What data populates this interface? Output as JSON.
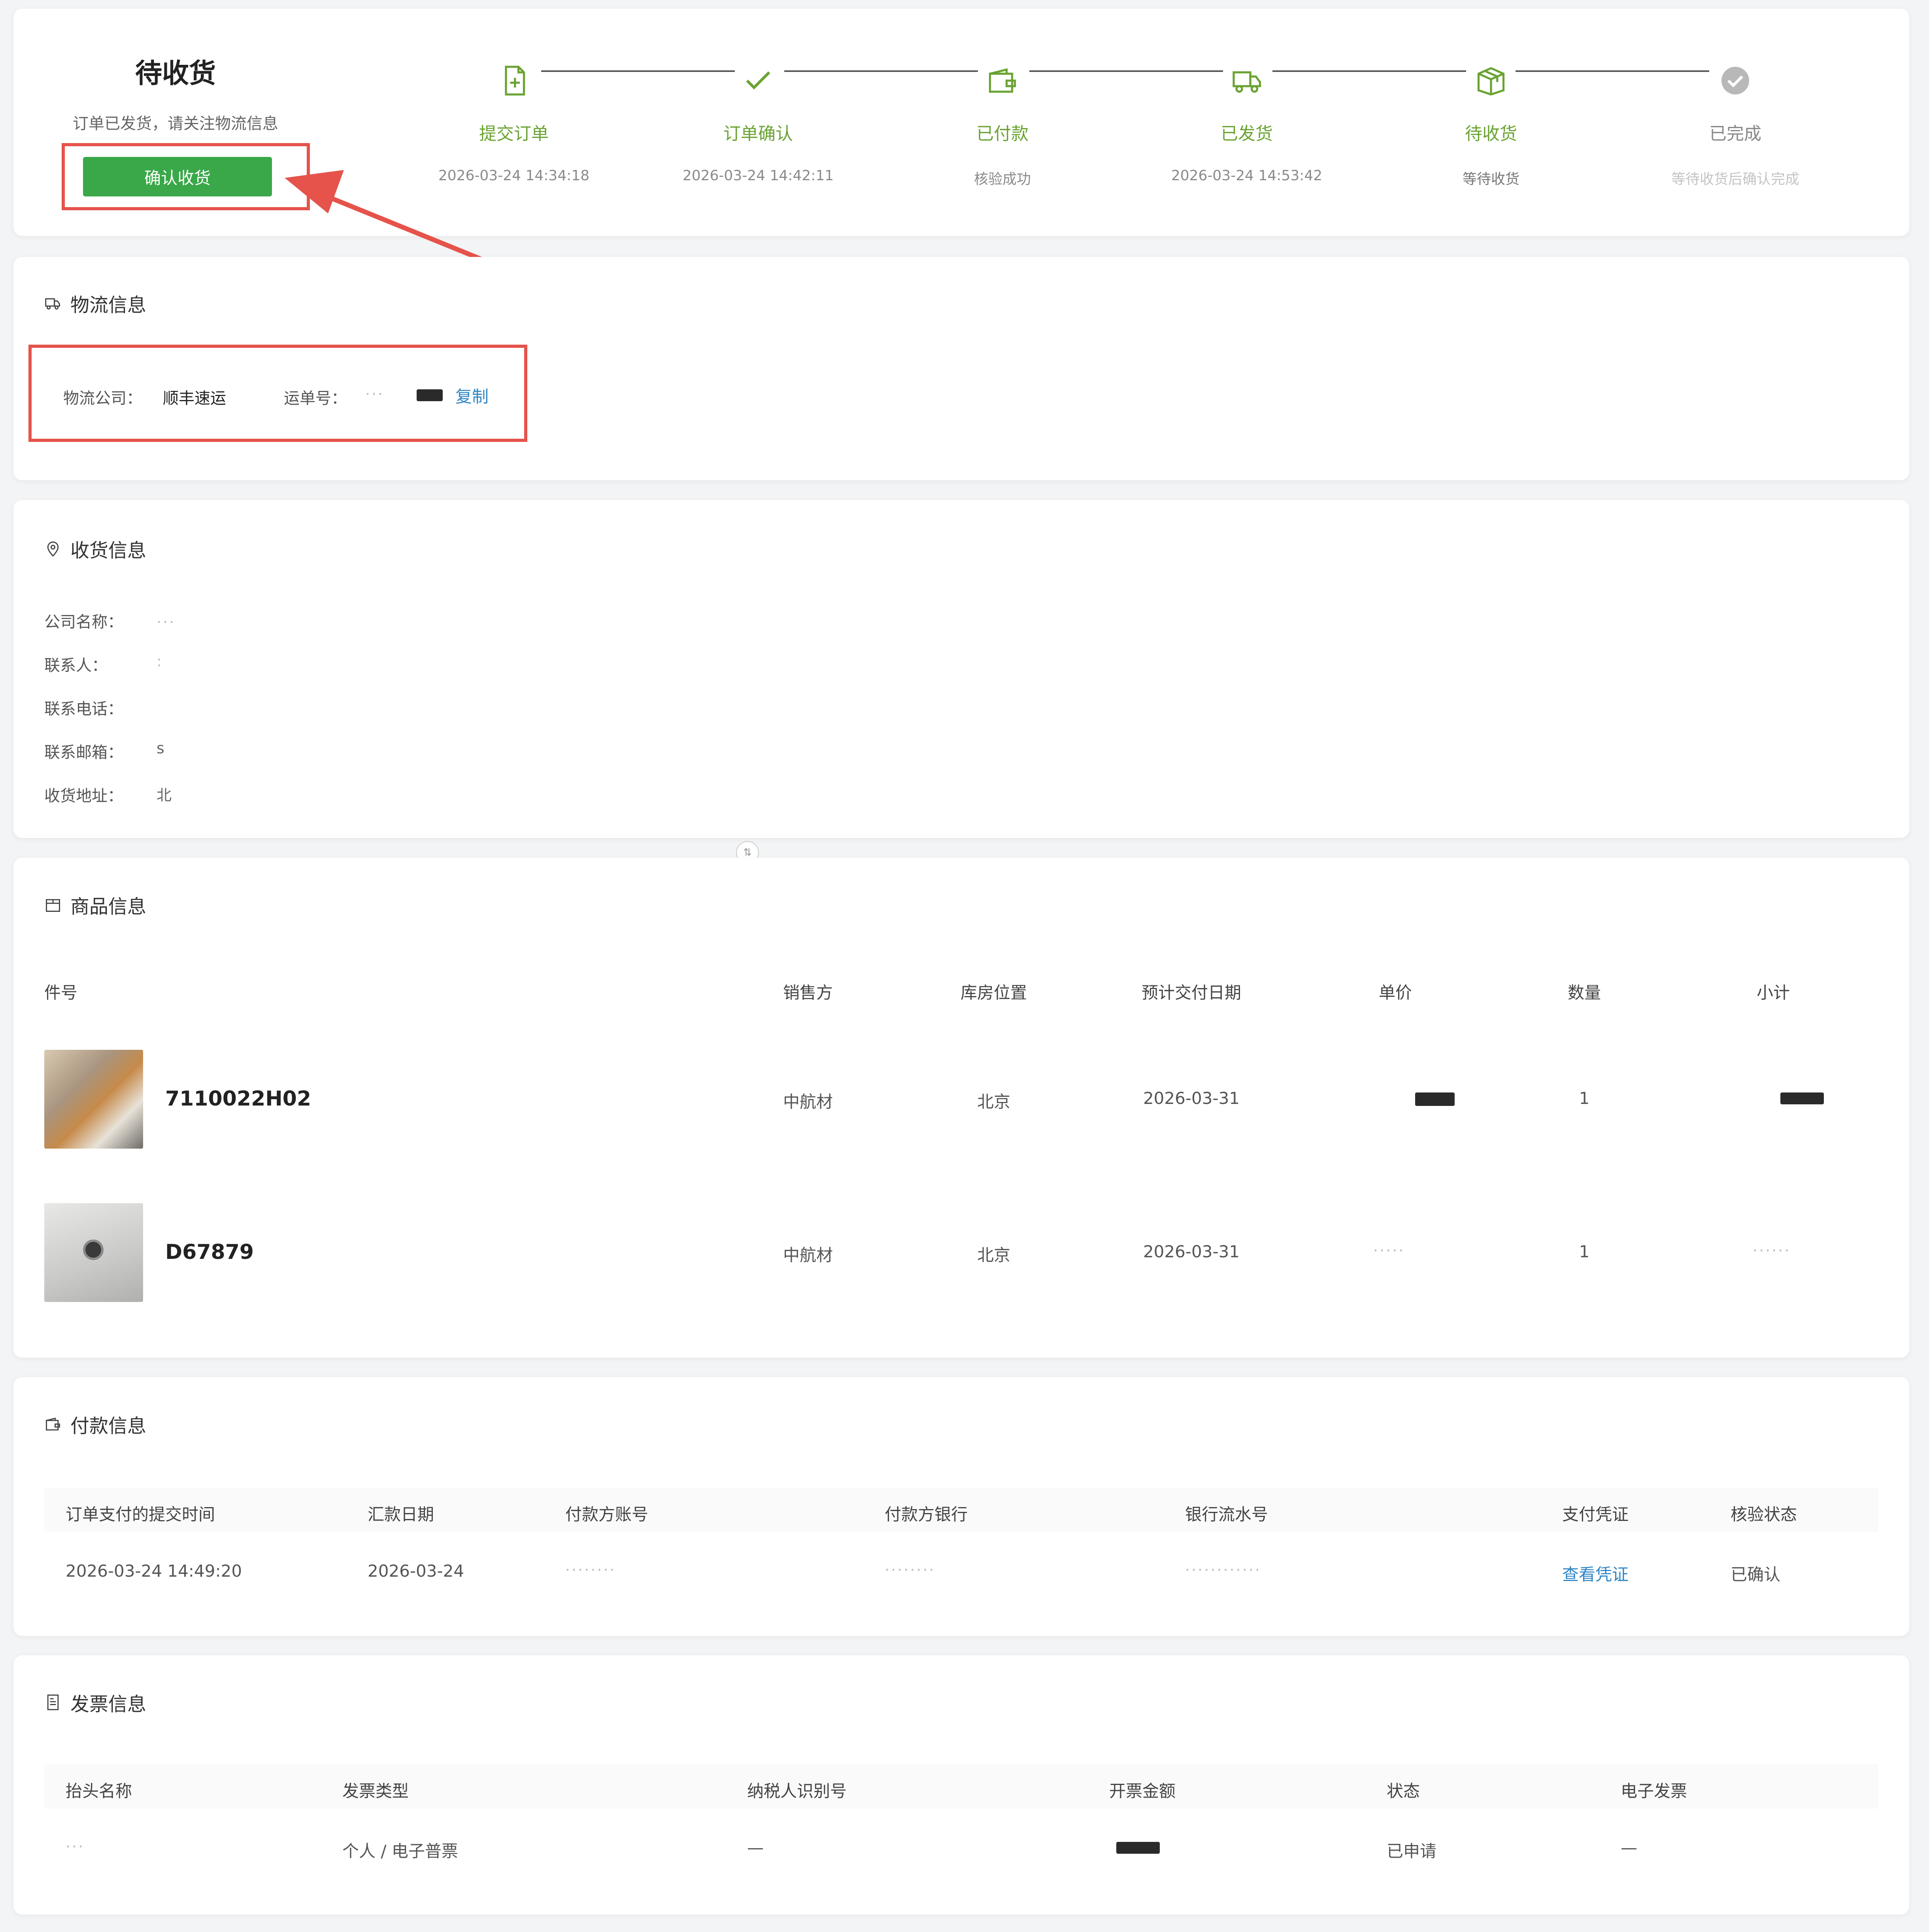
{
  "status": {
    "title": "待收货",
    "subtitle": "订单已发货，请关注物流信息",
    "confirm_button": "确认收货"
  },
  "steps": [
    {
      "label": "提交订单",
      "time": "2026-03-24 14:34:18",
      "icon": "document-plus-icon"
    },
    {
      "label": "订单确认",
      "time": "2026-03-24 14:42:11",
      "icon": "check-icon"
    },
    {
      "label": "已付款",
      "time": "核验成功",
      "icon": "wallet-icon"
    },
    {
      "label": "已发货",
      "time": "2026-03-24 14:53:42",
      "icon": "truck-icon"
    },
    {
      "label": "待收货",
      "time": "等待收货",
      "icon": "package-icon"
    },
    {
      "label": "已完成",
      "time": "等待收货后确认完成",
      "icon": "check-circle-icon"
    }
  ],
  "logistics": {
    "title": "物流信息",
    "company_label": "物流公司：",
    "company_value": "顺丰速运",
    "tracking_label": "运单号：",
    "copy_label": "复制"
  },
  "receiver": {
    "title": "收货信息",
    "fields": [
      {
        "label": "公司名称：",
        "value": "..."
      },
      {
        "label": "联系人：",
        "value": ":"
      },
      {
        "label": "联系电话：",
        "value": ""
      },
      {
        "label": "联系邮箱：",
        "value": "s"
      },
      {
        "label": "收货地址：",
        "value": "北"
      }
    ]
  },
  "products": {
    "title": "商品信息",
    "headers": [
      "件号",
      "销售方",
      "库房位置",
      "预计交付日期",
      "单价",
      "数量",
      "小计"
    ],
    "rows": [
      {
        "part_no": "7110022H02",
        "seller": "中航材",
        "warehouse": "北京",
        "delivery": "2026-03-31",
        "qty": "1"
      },
      {
        "part_no": "D67879",
        "seller": "中航材",
        "warehouse": "北京",
        "delivery": "2026-03-31",
        "qty": "1"
      }
    ]
  },
  "payment": {
    "title": "付款信息",
    "headers": [
      "订单支付的提交时间",
      "汇款日期",
      "付款方账号",
      "付款方银行",
      "银行流水号",
      "支付凭证",
      "核验状态"
    ],
    "row": {
      "submit_time": "2026-03-24 14:49:20",
      "remit_date": "2026-03-24",
      "voucher": "查看凭证",
      "status": "已确认"
    }
  },
  "invoice": {
    "title": "发票信息",
    "headers": [
      "抬头名称",
      "发票类型",
      "纳税人识别号",
      "开票金额",
      "状态",
      "电子发票"
    ],
    "row": {
      "type": "个人 / 电子普票",
      "tax_id": "—",
      "status": "已申请",
      "e_invoice": "—"
    }
  },
  "colors": {
    "accent": "#6aa332",
    "button": "#3aa849",
    "annotation": "#e5534b",
    "link": "#2f86c6"
  }
}
